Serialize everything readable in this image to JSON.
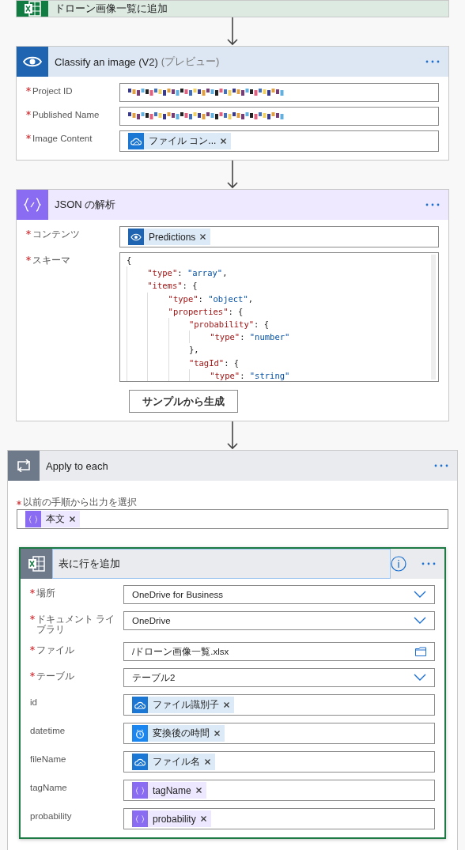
{
  "cards": [
    {
      "kind": "excel",
      "title": "ドローン画像一覧に追加"
    },
    {
      "kind": "vision",
      "title": "Classify an image (V2)",
      "subtitle": "(プレビュー)",
      "fields": [
        {
          "label": "Project ID",
          "required": true,
          "kind": "redacted"
        },
        {
          "label": "Published Name",
          "required": true,
          "kind": "redacted"
        },
        {
          "label": "Image Content",
          "required": true,
          "kind": "tokens",
          "tokens": [
            {
              "kind": "cloud",
              "text": "ファイル コン..."
            }
          ]
        }
      ]
    },
    {
      "kind": "json",
      "title": "JSON の解析",
      "fields": [
        {
          "label": "コンテンツ",
          "required": true,
          "kind": "tokens",
          "tokens": [
            {
              "kind": "eye",
              "text": "Predictions"
            }
          ]
        },
        {
          "label": "スキーマ",
          "required": true,
          "kind": "code",
          "lines": [
            "{",
            "    \"type\": \"array\",",
            "    \"items\": {",
            "        \"type\": \"object\",",
            "        \"properties\": {",
            "            \"probability\": {",
            "                \"type\": \"number\"",
            "            },",
            "            \"tagId\": {",
            "                \"type\": \"string\""
          ]
        }
      ],
      "button": "サンプルから生成"
    },
    {
      "kind": "loop",
      "title": "Apply to each",
      "loop_label": "以前の手順から出力を選択",
      "loop_required": true,
      "loop_tokens": [
        {
          "kind": "expr",
          "text": "本文"
        }
      ],
      "inner": {
        "kind": "excel",
        "title": "表に行を追加",
        "selected": true,
        "fields": [
          {
            "label": "場所",
            "required": true,
            "kind": "dropdown",
            "value": "OneDrive for Business"
          },
          {
            "label": "ドキュメント ライブラリ",
            "required": true,
            "kind": "dropdown",
            "value": "OneDrive"
          },
          {
            "label": "ファイル",
            "required": true,
            "kind": "file",
            "value": "/ドローン画像一覧.xlsx"
          },
          {
            "label": "テーブル",
            "required": true,
            "kind": "dropdown",
            "value": "テーブル2"
          },
          {
            "label": "id",
            "required": false,
            "kind": "tokens",
            "tokens": [
              {
                "kind": "cloud",
                "text": "ファイル識別子"
              }
            ]
          },
          {
            "label": "datetime",
            "required": false,
            "kind": "tokens",
            "tokens": [
              {
                "kind": "clock",
                "text": "変換後の時間"
              }
            ]
          },
          {
            "label": "fileName",
            "required": false,
            "kind": "tokens",
            "tokens": [
              {
                "kind": "cloud",
                "text": "ファイル名"
              }
            ]
          },
          {
            "label": "tagName",
            "required": false,
            "kind": "tokens",
            "tokens": [
              {
                "kind": "expr",
                "text": "tagName"
              }
            ]
          },
          {
            "label": "probability",
            "required": false,
            "kind": "tokens",
            "tokens": [
              {
                "kind": "expr",
                "text": "probability"
              }
            ]
          }
        ]
      }
    }
  ]
}
